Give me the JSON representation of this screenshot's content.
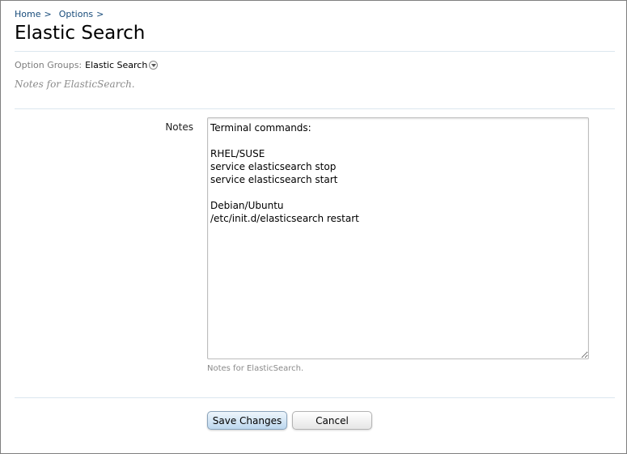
{
  "breadcrumb": {
    "items": [
      {
        "label": "Home",
        "sep": ">"
      },
      {
        "label": "Options",
        "sep": ">"
      }
    ]
  },
  "page": {
    "title": "Elastic Search"
  },
  "option_groups": {
    "label": "Option Groups:",
    "selected": "Elastic Search",
    "description": "Notes for ElasticSearch."
  },
  "form": {
    "notes": {
      "label": "Notes",
      "value": "Terminal commands:\n\nRHEL/SUSE\nservice elasticsearch stop\nservice elasticsearch start\n\nDebian/Ubuntu\n/etc/init.d/elasticsearch restart",
      "explain": "Notes for ElasticSearch."
    },
    "buttons": {
      "save_label": "Save Changes",
      "cancel_label": "Cancel"
    }
  },
  "icons": {
    "group_dropdown": "chevron-down-icon",
    "textarea_resize": "resize-grip-icon"
  },
  "colors": {
    "link": "#174b7a",
    "divider": "#dbe7ef",
    "muted_text": "#8a8a8a",
    "save_button_top": "#eef6fc",
    "save_button_bottom": "#bcd7ee"
  }
}
